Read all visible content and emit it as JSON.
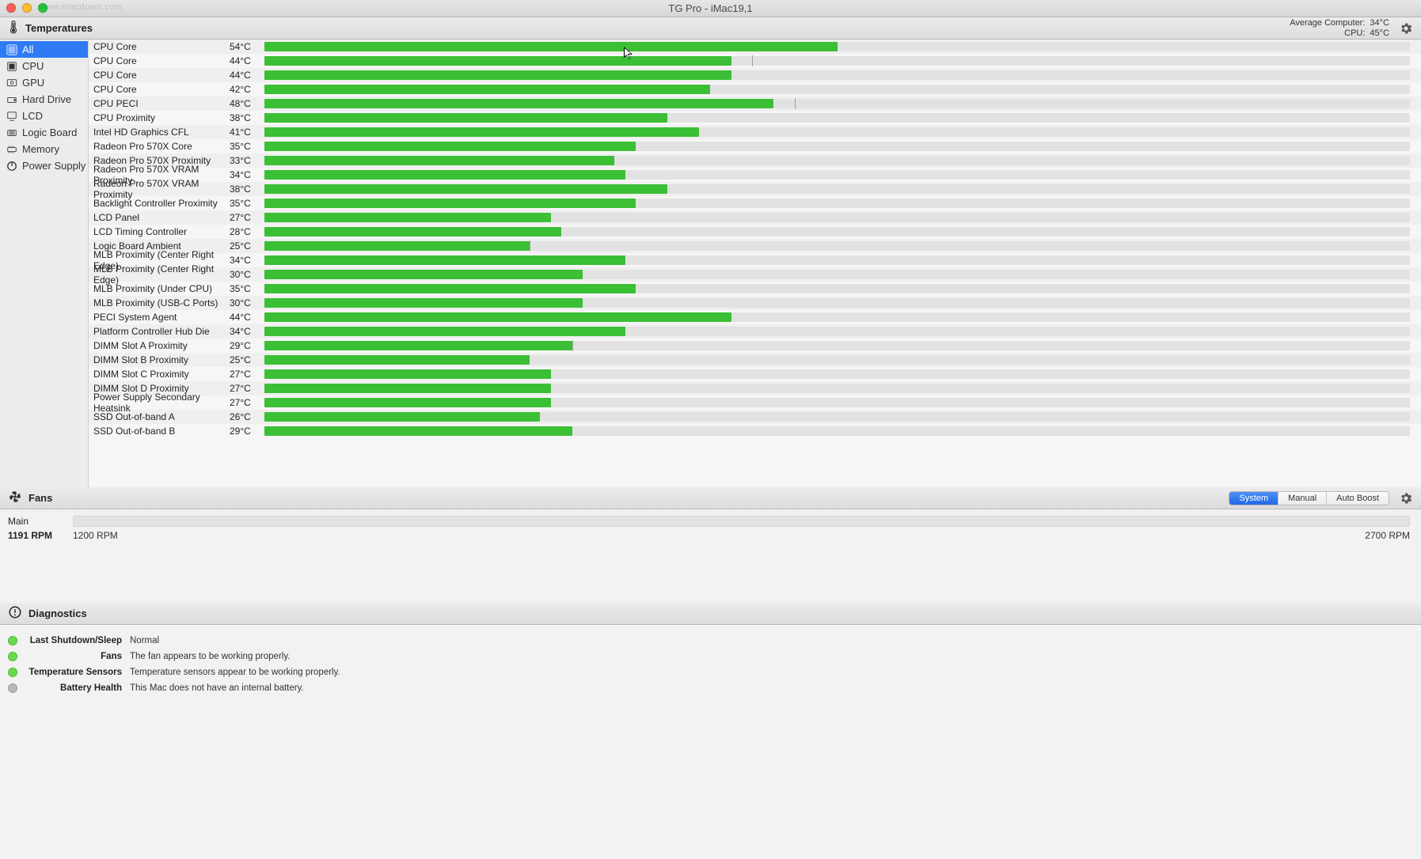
{
  "window": {
    "title": "TG Pro - iMac19,1",
    "watermark": "www.macdown.com"
  },
  "header_temps": {
    "title": "Temperatures",
    "summary": {
      "avg_label": "Average Computer:",
      "avg_value": "34°C",
      "cpu_label": "CPU:",
      "cpu_value": "45°C"
    }
  },
  "sidebar": {
    "items": [
      {
        "label": "All",
        "selected": true
      },
      {
        "label": "CPU",
        "selected": false
      },
      {
        "label": "GPU",
        "selected": false
      },
      {
        "label": "Hard Drive",
        "selected": false
      },
      {
        "label": "LCD",
        "selected": false
      },
      {
        "label": "Logic Board",
        "selected": false
      },
      {
        "label": "Memory",
        "selected": false
      },
      {
        "label": "Power Supply",
        "selected": false
      }
    ]
  },
  "temp_max": 108,
  "sensors": [
    {
      "name": "CPU Core",
      "tempC": 54,
      "tick": null
    },
    {
      "name": "CPU Core",
      "tempC": 44,
      "tick": 46
    },
    {
      "name": "CPU Core",
      "tempC": 44,
      "tick": null
    },
    {
      "name": "CPU Core",
      "tempC": 42,
      "tick": null
    },
    {
      "name": "CPU PECI",
      "tempC": 48,
      "tick": 50
    },
    {
      "name": "CPU Proximity",
      "tempC": 38,
      "tick": null
    },
    {
      "name": "Intel HD Graphics CFL",
      "tempC": 41,
      "tick": null
    },
    {
      "name": "Radeon Pro 570X Core",
      "tempC": 35,
      "tick": null
    },
    {
      "name": "Radeon Pro 570X Proximity",
      "tempC": 33,
      "tick": null
    },
    {
      "name": "Radeon Pro 570X VRAM Proximity",
      "tempC": 34,
      "tick": null
    },
    {
      "name": "Radeon Pro 570X VRAM Proximity",
      "tempC": 38,
      "tick": null
    },
    {
      "name": "Backlight Controller Proximity",
      "tempC": 35,
      "tick": null
    },
    {
      "name": "LCD Panel",
      "tempC": 27,
      "tick": null
    },
    {
      "name": "LCD Timing Controller",
      "tempC": 28,
      "tick": null
    },
    {
      "name": "Logic Board Ambient",
      "tempC": 25,
      "tick": 25
    },
    {
      "name": "MLB Proximity (Center Right Edge)",
      "tempC": 34,
      "tick": null
    },
    {
      "name": "MLB Proximity (Center Right Edge)",
      "tempC": 30,
      "tick": null
    },
    {
      "name": "MLB Proximity (Under CPU)",
      "tempC": 35,
      "tick": null
    },
    {
      "name": "MLB Proximity (USB-C Ports)",
      "tempC": 30,
      "tick": null
    },
    {
      "name": "PECI System Agent",
      "tempC": 44,
      "tick": null
    },
    {
      "name": "Platform Controller Hub Die",
      "tempC": 34,
      "tick": null
    },
    {
      "name": "DIMM Slot A Proximity",
      "tempC": 29,
      "tick": 29
    },
    {
      "name": "DIMM Slot B Proximity",
      "tempC": 25,
      "tick": null
    },
    {
      "name": "DIMM Slot C Proximity",
      "tempC": 27,
      "tick": null
    },
    {
      "name": "DIMM Slot D Proximity",
      "tempC": 27,
      "tick": null
    },
    {
      "name": "Power Supply Secondary Heatsink",
      "tempC": 27,
      "tick": null
    },
    {
      "name": "SSD Out-of-band A",
      "tempC": 26,
      "tick": null
    },
    {
      "name": "SSD Out-of-band B",
      "tempC": 29,
      "tick": null
    }
  ],
  "fans_header": {
    "title": "Fans",
    "segments": [
      {
        "label": "System",
        "selected": true
      },
      {
        "label": "Manual",
        "selected": false
      },
      {
        "label": "Auto Boost",
        "selected": false
      }
    ]
  },
  "fans": [
    {
      "name": "Main",
      "current": "1191 RPM",
      "min": "1200 RPM",
      "max": "2700 RPM"
    }
  ],
  "diag_header": {
    "title": "Diagnostics"
  },
  "diagnostics": [
    {
      "status": "ok",
      "label": "Last Shutdown/Sleep",
      "value": "Normal"
    },
    {
      "status": "ok",
      "label": "Fans",
      "value": "The fan appears to be working properly."
    },
    {
      "status": "ok",
      "label": "Temperature Sensors",
      "value": "Temperature sensors appear to be working properly."
    },
    {
      "status": "na",
      "label": "Battery Health",
      "value": "This Mac does not have an internal battery."
    }
  ]
}
